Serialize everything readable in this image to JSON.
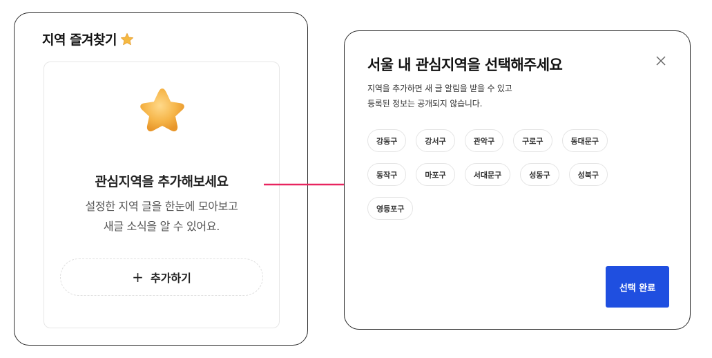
{
  "favorites_card": {
    "title": "지역 즐겨찾기",
    "empty_title": "관심지역을 추가해보세요",
    "empty_desc_line1": "설정한 지역 글을 한눈에 모아보고",
    "empty_desc_line2": "새글 소식을 알 수 있어요.",
    "add_icon": "+",
    "add_label": "추가하기"
  },
  "modal": {
    "title": "서울 내 관심지역을 선택해주세요",
    "desc_line1": "지역을 추가하면 새 글 알림을 받을 수 있고",
    "desc_line2": "등록된 정보는 공개되지 않습니다.",
    "close_icon": "close-icon",
    "chips": [
      "강동구",
      "강서구",
      "관악구",
      "구로구",
      "동대문구",
      "동작구",
      "마포구",
      "서대문구",
      "성동구",
      "성북구",
      "영등포구"
    ],
    "done_label": "선택 완료"
  },
  "colors": {
    "accent": "#1f4fe0",
    "arrow": "#e8245f",
    "star": "#f5b942"
  }
}
